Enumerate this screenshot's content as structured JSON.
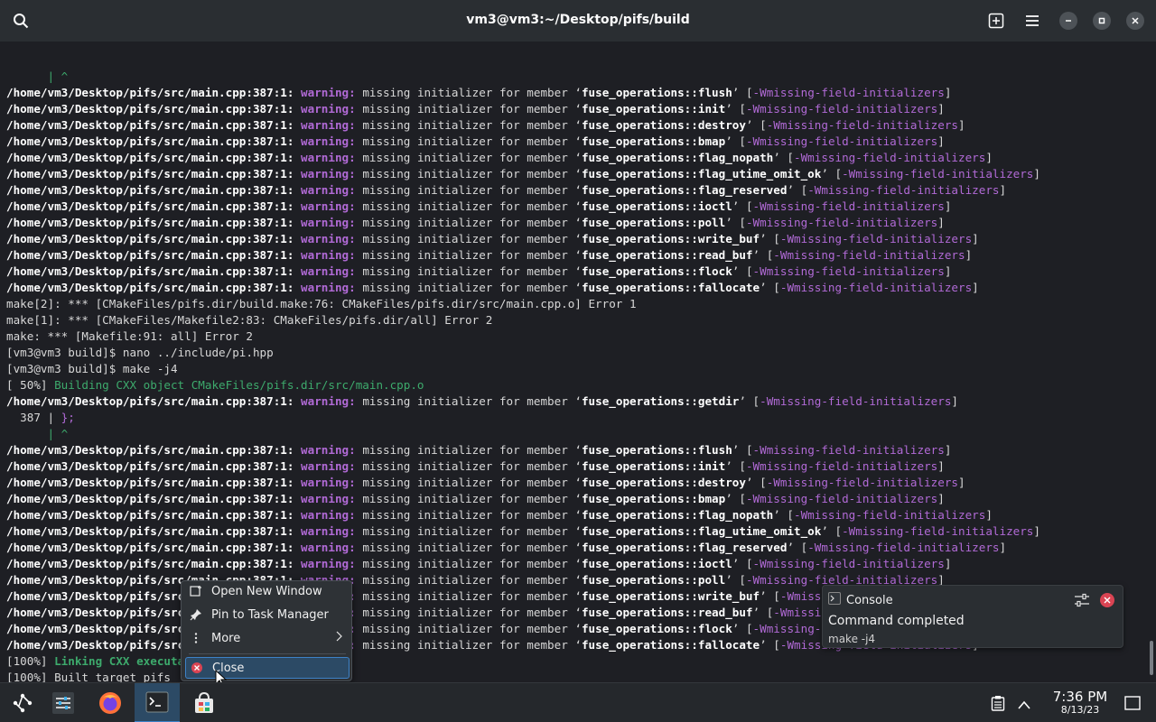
{
  "window": {
    "title": "vm3@vm3:~/Desktop/pifs/build"
  },
  "terminal": {
    "caret": "      | ^",
    "file": "/home/vm3/Desktop/pifs/src/main.cpp:387:1:",
    "warn_label": "warning:",
    "warn_text": "missing initializer for member",
    "flag": "-Wmissing-field-initializers",
    "members_1": [
      "flush",
      "init",
      "destroy",
      "bmap",
      "flag_nopath",
      "flag_utime_omit_ok",
      "flag_reserved",
      "ioctl",
      "poll",
      "write_buf",
      "read_buf",
      "flock",
      "fallocate"
    ],
    "members_2": [
      "flush",
      "init",
      "destroy",
      "bmap",
      "flag_nopath",
      "flag_utime_omit_ok",
      "flag_reserved",
      "ioctl",
      "poll",
      "write_buf",
      "read_buf",
      "flock",
      "fallocate"
    ],
    "make2_error": "make[2]: *** [CMakeFiles/pifs.dir/build.make:76: CMakeFiles/pifs.dir/src/main.cpp.o] Error 1",
    "make1_error": "make[1]: *** [CMakeFiles/Makefile2:83: CMakeFiles/pifs.dir/all] Error 2",
    "make_error": "make: *** [Makefile:91: all] Error 2",
    "prompt": "[vm3@vm3 build]$",
    "cmd_nano": " nano ../include/pi.hpp",
    "cmd_make": " make -j4",
    "build_pct": "[ 50%]",
    "build_msg": " Building CXX object CMakeFiles/pifs.dir/src/main.cpp.o",
    "getdir_member": "getdir",
    "src_line_no": "  387 | ",
    "src_line_code": "};",
    "link_pct": "[100%]",
    "link_msg": " Linking CXX executable pifs",
    "built_msg": "[100%] Built target pifs"
  },
  "context_menu": {
    "items": [
      {
        "icon": "window-plus-icon",
        "label": "Open New Window"
      },
      {
        "icon": "pin-icon",
        "label": "Pin to Task Manager"
      },
      {
        "icon": "more-icon",
        "label": "More"
      },
      {
        "icon": "close-circle-icon",
        "label": "Close"
      }
    ]
  },
  "notification": {
    "app": "Console",
    "title": "Command completed",
    "body": "make -j4"
  },
  "taskbar": {
    "time": "7:36 PM",
    "date": "8/13/23"
  },
  "colors": {
    "accent": "#3d82c8",
    "warning": "#b16ad6",
    "green": "#3daa6c",
    "close_red": "#da4453"
  }
}
